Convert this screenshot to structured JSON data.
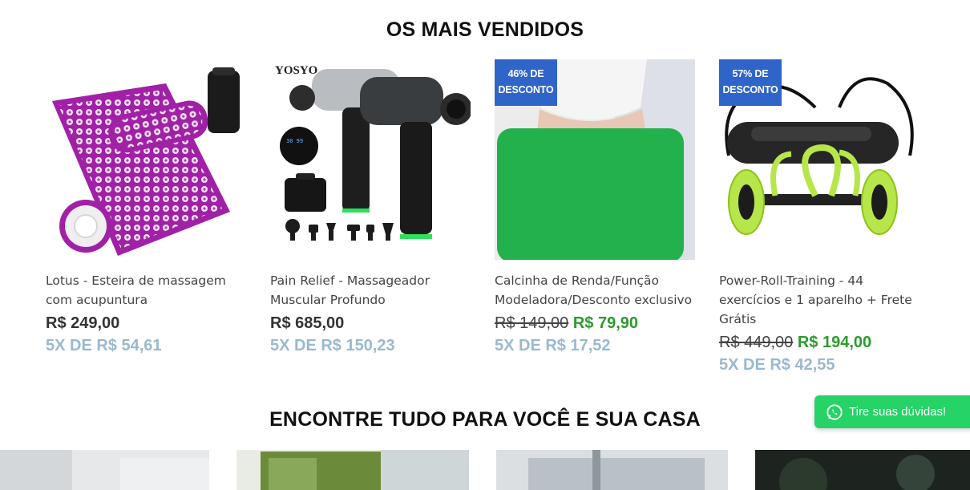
{
  "sections": {
    "best_sellers_title": "OS MAIS VENDIDOS",
    "home_title": "ENCONTRE TUDO PARA VOCÊ E SUA CASA"
  },
  "products": [
    {
      "name": "Lotus - Esteira de massagem com acupuntura",
      "price": "R$ 249,00",
      "installment": "5X DE R$ 54,61"
    },
    {
      "name": "Pain Relief - Massageador Muscular Profundo",
      "brand": "YOSYO",
      "price": "R$ 685,00",
      "installment": "5X DE R$ 150,23"
    },
    {
      "name": "Calcinha de Renda/Função Modeladora/Desconto exclusivo",
      "badge": "46% DE DESCONTO",
      "old_price": "R$ 149,00",
      "sale_price": "R$ 79,90",
      "installment": "5X DE R$ 17,52"
    },
    {
      "name": "Power-Roll-Training - 44 exercícios e 1 aparelho + Frete Grátis",
      "badge": "57% DE DESCONTO",
      "old_price": "R$ 449,00",
      "sale_price": "R$ 194,00",
      "installment": "5X DE R$ 42,55"
    }
  ],
  "whatsapp": {
    "label": "Tire suas dúvidas!",
    "icon": "whatsapp-icon",
    "color": "#25d366"
  },
  "colors": {
    "badge": "#2f64c9",
    "sale_price": "#2c9b2c",
    "installment": "#9ab9cf"
  }
}
